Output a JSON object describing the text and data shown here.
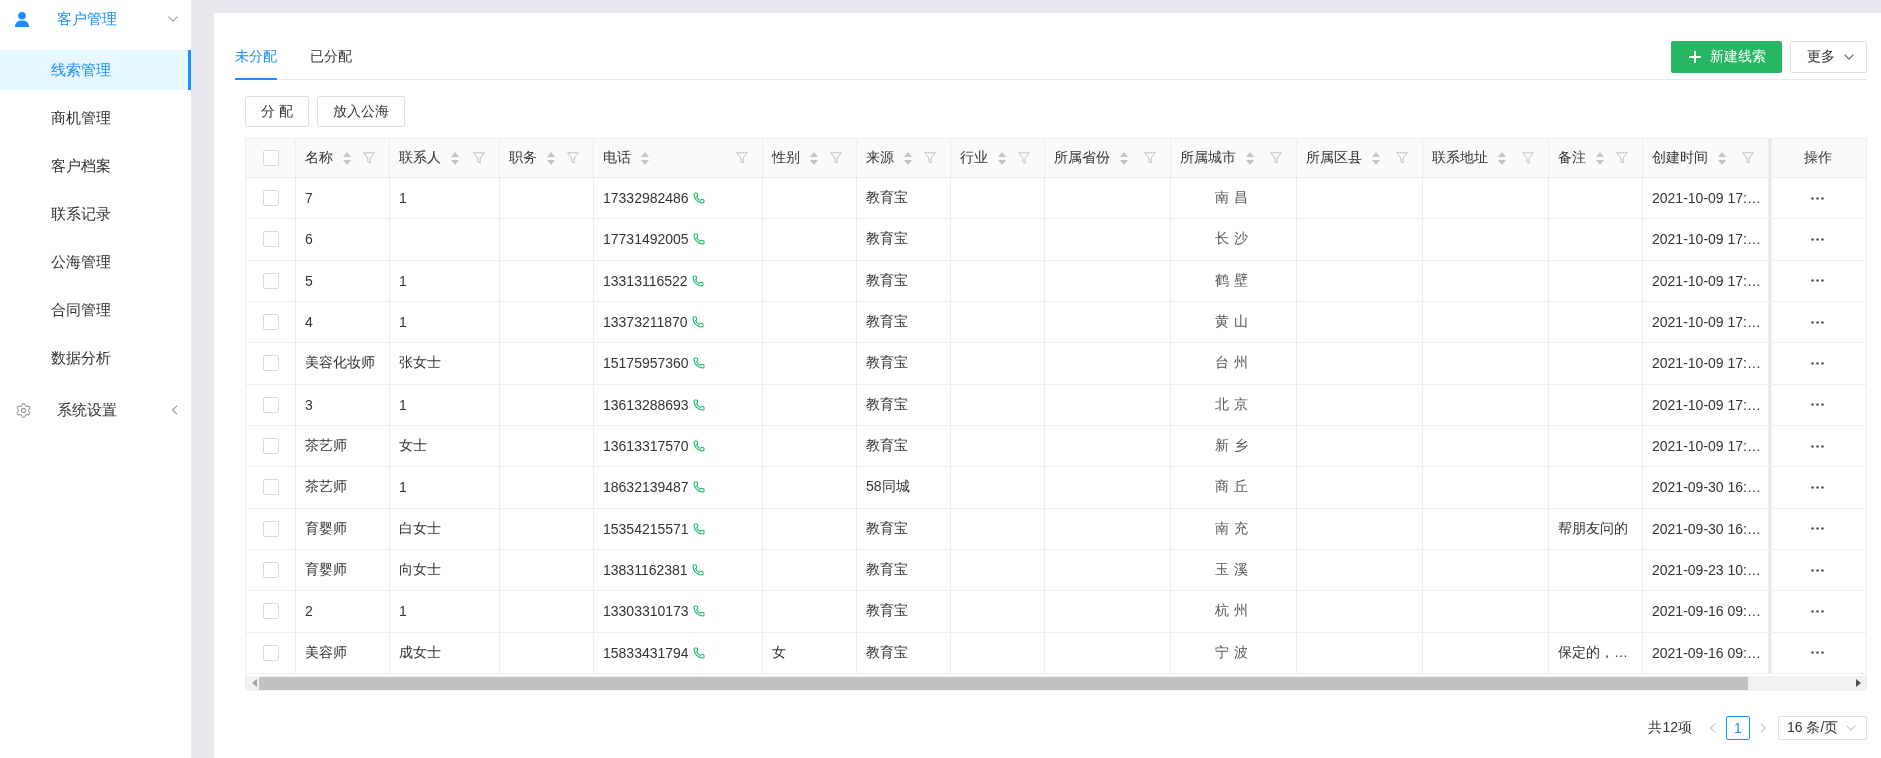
{
  "sidebar": {
    "groups": [
      {
        "label": "客户管理",
        "expanded": true,
        "items": [
          {
            "label": "线索管理",
            "selected": true
          },
          {
            "label": "商机管理",
            "selected": false
          },
          {
            "label": "客户档案",
            "selected": false
          },
          {
            "label": "联系记录",
            "selected": false
          },
          {
            "label": "公海管理",
            "selected": false
          },
          {
            "label": "合同管理",
            "selected": false
          },
          {
            "label": "数据分析",
            "selected": false
          }
        ]
      },
      {
        "label": "系统设置",
        "expanded": false
      }
    ]
  },
  "tabs": [
    {
      "label": "未分配",
      "selected": true
    },
    {
      "label": "已分配",
      "selected": false
    }
  ],
  "header_buttons": [
    {
      "label": "新建线索",
      "kind": "primary"
    },
    {
      "label": "更多",
      "kind": "dropdown"
    }
  ],
  "toolbar_buttons": [
    "分 配",
    "放入公海"
  ],
  "table": {
    "select_all": {
      "checked": false
    },
    "columns": [
      {
        "label": "名称"
      },
      {
        "label": "联系人"
      },
      {
        "label": "职务"
      },
      {
        "label": "电话"
      },
      {
        "label": "性别"
      },
      {
        "label": "来源"
      },
      {
        "label": "行业"
      },
      {
        "label": "所属省份"
      },
      {
        "label": "所属城市"
      },
      {
        "label": "所属区县"
      },
      {
        "label": "联系地址"
      },
      {
        "label": "备注"
      },
      {
        "label": "创建时间"
      }
    ],
    "action_column": {
      "label": "操作"
    },
    "rows": [
      {
        "checked": false,
        "name": "7",
        "contact": "1",
        "phone": "17332982486",
        "source": "教育宝",
        "city": "南昌",
        "created": "2021-10-09 17:…"
      },
      {
        "checked": false,
        "name": "6",
        "phone": "17731492005",
        "source": "教育宝",
        "city": "长沙",
        "created": "2021-10-09 17:…"
      },
      {
        "checked": false,
        "name": "5",
        "contact": "1",
        "phone": "13313116522",
        "source": "教育宝",
        "city": "鹤壁",
        "created": "2021-10-09 17:…"
      },
      {
        "checked": false,
        "name": "4",
        "contact": "1",
        "phone": "13373211870",
        "source": "教育宝",
        "city": "黄山",
        "created": "2021-10-09 17:…"
      },
      {
        "checked": false,
        "name": "美容化妆师",
        "contact": "张女士",
        "phone": "15175957360",
        "source": "教育宝",
        "city": "台州",
        "created": "2021-10-09 17:…"
      },
      {
        "checked": false,
        "name": "3",
        "contact": "1",
        "phone": "13613288693",
        "source": "教育宝",
        "city": "北京",
        "created": "2021-10-09 17:…"
      },
      {
        "checked": false,
        "name": "茶艺师",
        "contact": "女士",
        "phone": "13613317570",
        "source": "教育宝",
        "city": "新乡",
        "created": "2021-10-09 17:…"
      },
      {
        "checked": false,
        "name": "茶艺师",
        "contact": "1",
        "phone": "18632139487",
        "source": "58同城",
        "city": "商丘",
        "created": "2021-09-30 16:…"
      },
      {
        "checked": false,
        "name": "育婴师",
        "contact": "白女士",
        "phone": "15354215571",
        "source": "教育宝",
        "city": "南充",
        "note": "帮朋友问的",
        "created": "2021-09-30 16:…"
      },
      {
        "checked": false,
        "name": "育婴师",
        "contact": "向女士",
        "phone": "13831162381",
        "source": "教育宝",
        "city": "玉溪",
        "created": "2021-09-23 10:…"
      },
      {
        "checked": false,
        "name": "2",
        "contact": "1",
        "phone": "13303310173",
        "source": "教育宝",
        "city": "杭州",
        "created": "2021-09-16 09:…"
      },
      {
        "checked": false,
        "name": "美容师",
        "contact": "成女士",
        "phone": "15833431794",
        "gender": "女",
        "source": "教育宝",
        "city": "宁波",
        "note": "保定的，…",
        "created": "2021-09-16 09:…"
      }
    ]
  },
  "pagination": {
    "total": "共12项",
    "prev": {
      "disabled": true
    },
    "pages": [
      {
        "label": "1",
        "selected": true
      }
    ],
    "next": {
      "disabled": true
    },
    "page_size": "16 条/页"
  }
}
